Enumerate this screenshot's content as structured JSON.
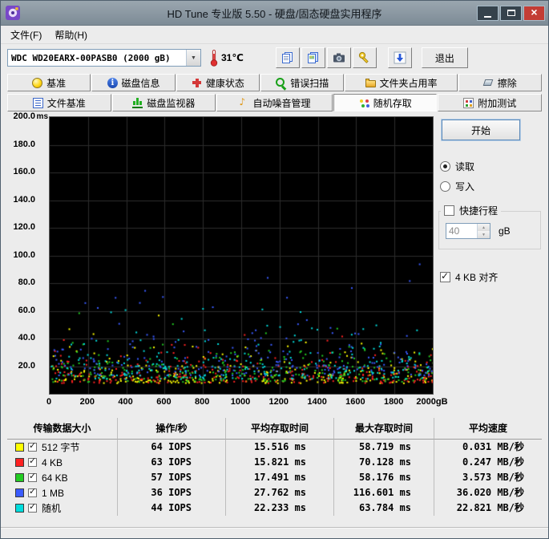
{
  "window": {
    "title": "HD Tune 专业版 5.50 - 硬盘/固态硬盘实用程序",
    "window_button_icons": [
      "minimize-icon",
      "maximize-icon",
      "close-icon"
    ]
  },
  "menu": {
    "file": "文件(F)",
    "help": "帮助(H)"
  },
  "toolbar": {
    "drive_select": "WDC WD20EARX-00PASB0 (2000 gB)",
    "temperature": "31℃",
    "exit_label": "退出",
    "icon_buttons": [
      "copy-text-icon",
      "copy-image-icon",
      "screenshot-camera-icon",
      "options-keys-icon",
      "save-results-arrow-icon"
    ],
    "thermometer_icon": "thermometer-icon"
  },
  "tabs": {
    "row1": [
      {
        "label": "基准",
        "icon": "lightbulb-icon"
      },
      {
        "label": "磁盘信息",
        "icon": "info-icon"
      },
      {
        "label": "健康状态",
        "icon": "health-cross-icon"
      },
      {
        "label": "错误扫描",
        "icon": "error-scan-magnifier-icon"
      },
      {
        "label": "文件夹占用率",
        "icon": "folder-icon"
      },
      {
        "label": "擦除",
        "icon": "eraser-icon"
      }
    ],
    "row2": [
      {
        "label": "文件基准",
        "icon": "file-benchmark-icon"
      },
      {
        "label": "磁盘监视器",
        "icon": "disk-monitor-bars-icon"
      },
      {
        "label": "自动噪音管理",
        "icon": "speaker-note-icon"
      },
      {
        "label": "随机存取",
        "icon": "random-dots-icon",
        "active": true
      },
      {
        "label": "附加测试",
        "icon": "extra-tests-icon"
      }
    ]
  },
  "controls": {
    "start_label": "开始",
    "read_label": "读取",
    "write_label": "写入",
    "read_selected": true,
    "short_stroke_label": "快捷行程",
    "short_stroke_checked": false,
    "short_stroke_value": "40",
    "short_stroke_unit": "gB",
    "align_label": "4 KB 对齐",
    "align_checked": true
  },
  "chart_data": {
    "type": "scatter",
    "background": "#000000",
    "grid": true,
    "grid_color": "#2c2c2c",
    "x_axis": {
      "min": 0,
      "max": 2000,
      "tick_labels": [
        "0",
        "200",
        "400",
        "600",
        "800",
        "1000",
        "1200",
        "1400",
        "1600",
        "1800",
        "2000gB"
      ]
    },
    "y_axis": {
      "min": 0,
      "max": 200,
      "unit": "ms",
      "tick_labels": [
        "200.0",
        "180.0",
        "160.0",
        "140.0",
        "120.0",
        "100.0",
        "80.0",
        "60.0",
        "40.0",
        "20.0"
      ]
    },
    "series": [
      {
        "name": "512 字节",
        "color": "#ffff00",
        "avg_access_ms": 15.516,
        "max_access_ms": 58.719
      },
      {
        "name": "4 KB",
        "color": "#ff2222",
        "avg_access_ms": 15.821,
        "max_access_ms": 70.128
      },
      {
        "name": "64 KB",
        "color": "#22cc22",
        "avg_access_ms": 17.491,
        "max_access_ms": 58.176
      },
      {
        "name": "1 MB",
        "color": "#3a5bff",
        "avg_access_ms": 27.762,
        "max_access_ms": 116.601
      },
      {
        "name": "随机",
        "color": "#00dddd",
        "avg_access_ms": 22.233,
        "max_access_ms": 63.784
      }
    ]
  },
  "results": {
    "headers": [
      "传输数据大小",
      "操作/秒",
      "平均存取时间",
      "最大存取时间",
      "平均速度"
    ],
    "rows": [
      {
        "checked": true,
        "color": "#ffff00",
        "label": "512 字节",
        "ops": "64 IOPS",
        "avg": "15.516 ms",
        "max": "58.719 ms",
        "speed": "0.031 MB/秒"
      },
      {
        "checked": true,
        "color": "#ff2222",
        "label": "4 KB",
        "ops": "63 IOPS",
        "avg": "15.821 ms",
        "max": "70.128 ms",
        "speed": "0.247 MB/秒"
      },
      {
        "checked": true,
        "color": "#22cc22",
        "label": "64 KB",
        "ops": "57 IOPS",
        "avg": "17.491 ms",
        "max": "58.176 ms",
        "speed": "3.573 MB/秒"
      },
      {
        "checked": true,
        "color": "#3a5bff",
        "label": "1 MB",
        "ops": "36 IOPS",
        "avg": "27.762 ms",
        "max": "116.601 ms",
        "speed": "36.020 MB/秒"
      },
      {
        "checked": true,
        "color": "#00dddd",
        "label": "随机",
        "ops": "44 IOPS",
        "avg": "22.233 ms",
        "max": "63.784 ms",
        "speed": "22.821 MB/秒"
      }
    ]
  }
}
